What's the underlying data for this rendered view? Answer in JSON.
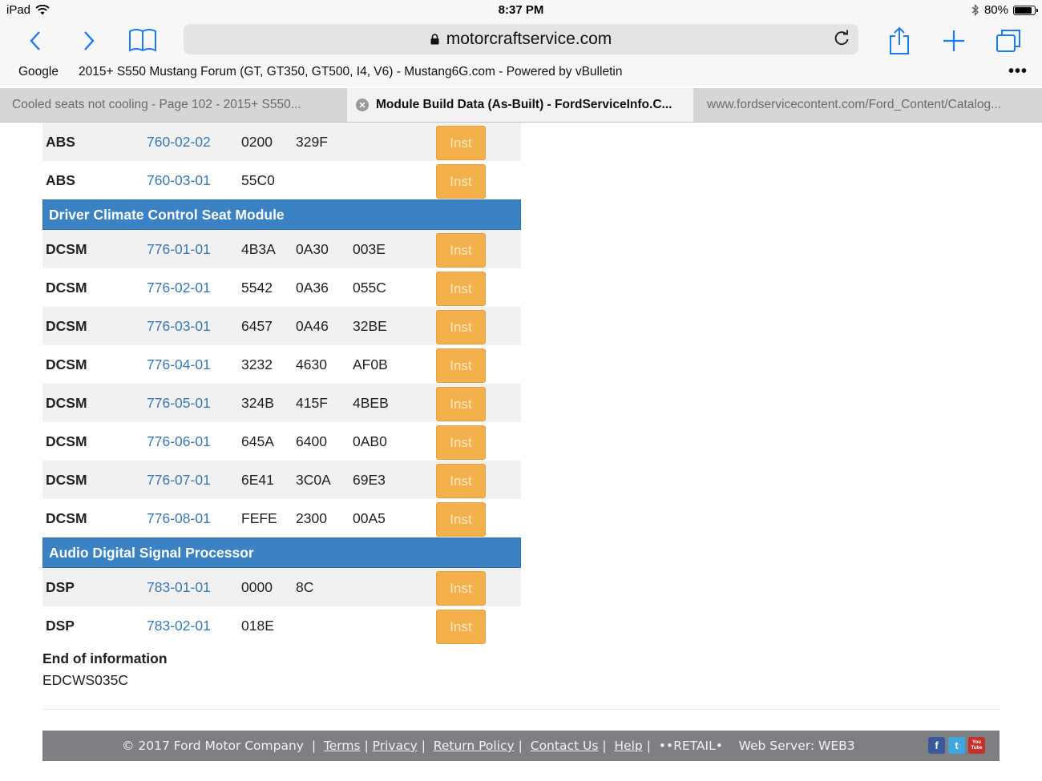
{
  "status": {
    "device": "iPad",
    "time": "8:37 PM",
    "battery": "80%"
  },
  "browser": {
    "url": "motorcraftservice.com",
    "favorites": [
      "Google",
      "2015+ S550 Mustang Forum (GT, GT350, GT500, I4, V6) - Mustang6G.com - Powered by vBulletin"
    ],
    "more": "•••",
    "tabs": [
      {
        "label": "Cooled seats not cooling - Page 102 - 2015+ S550..."
      },
      {
        "label": "Module Build Data (As-Built) - FordServiceInfo.C..."
      },
      {
        "label": "www.fordservicecontent.com/Ford_Content/Catalog..."
      }
    ]
  },
  "inst_label": "Inst",
  "sections": [
    {
      "title": "",
      "rows": [
        {
          "module": "ABS",
          "part": "760-02-02",
          "v1": "0200",
          "v2": "329F",
          "v3": ""
        },
        {
          "module": "ABS",
          "part": "760-03-01",
          "v1": "55C0",
          "v2": "",
          "v3": ""
        }
      ]
    },
    {
      "title": "Driver Climate Control Seat Module",
      "rows": [
        {
          "module": "DCSM",
          "part": "776-01-01",
          "v1": "4B3A",
          "v2": "0A30",
          "v3": "003E"
        },
        {
          "module": "DCSM",
          "part": "776-02-01",
          "v1": "5542",
          "v2": "0A36",
          "v3": "055C"
        },
        {
          "module": "DCSM",
          "part": "776-03-01",
          "v1": "6457",
          "v2": "0A46",
          "v3": "32BE"
        },
        {
          "module": "DCSM",
          "part": "776-04-01",
          "v1": "3232",
          "v2": "4630",
          "v3": "AF0B"
        },
        {
          "module": "DCSM",
          "part": "776-05-01",
          "v1": "324B",
          "v2": "415F",
          "v3": "4BEB"
        },
        {
          "module": "DCSM",
          "part": "776-06-01",
          "v1": "645A",
          "v2": "6400",
          "v3": "0AB0"
        },
        {
          "module": "DCSM",
          "part": "776-07-01",
          "v1": "6E41",
          "v2": "3C0A",
          "v3": "69E3"
        },
        {
          "module": "DCSM",
          "part": "776-08-01",
          "v1": "FEFE",
          "v2": "2300",
          "v3": "00A5"
        }
      ]
    },
    {
      "title": "Audio Digital Signal Processor",
      "rows": [
        {
          "module": "DSP",
          "part": "783-01-01",
          "v1": "0000",
          "v2": "8C",
          "v3": ""
        },
        {
          "module": "DSP",
          "part": "783-02-01",
          "v1": "018E",
          "v2": "",
          "v3": ""
        }
      ]
    }
  ],
  "end": {
    "title": "End of information",
    "code": "EDCWS035C"
  },
  "footer": {
    "copyright": "© 2017 Ford Motor Company",
    "links": [
      "Terms",
      "Privacy",
      "Return Policy",
      "Contact Us",
      "Help"
    ],
    "retail": "••RETAIL•",
    "server": "Web Server: WEB3",
    "social": [
      "f",
      "t",
      "You Tube"
    ]
  },
  "colors": {
    "section_bg": "#3a82c4",
    "inst_bg": "#f4b04a",
    "link": "#3a78b5",
    "ios_blue": "#1a7cf5",
    "footer_bg": "#7d7f82"
  }
}
